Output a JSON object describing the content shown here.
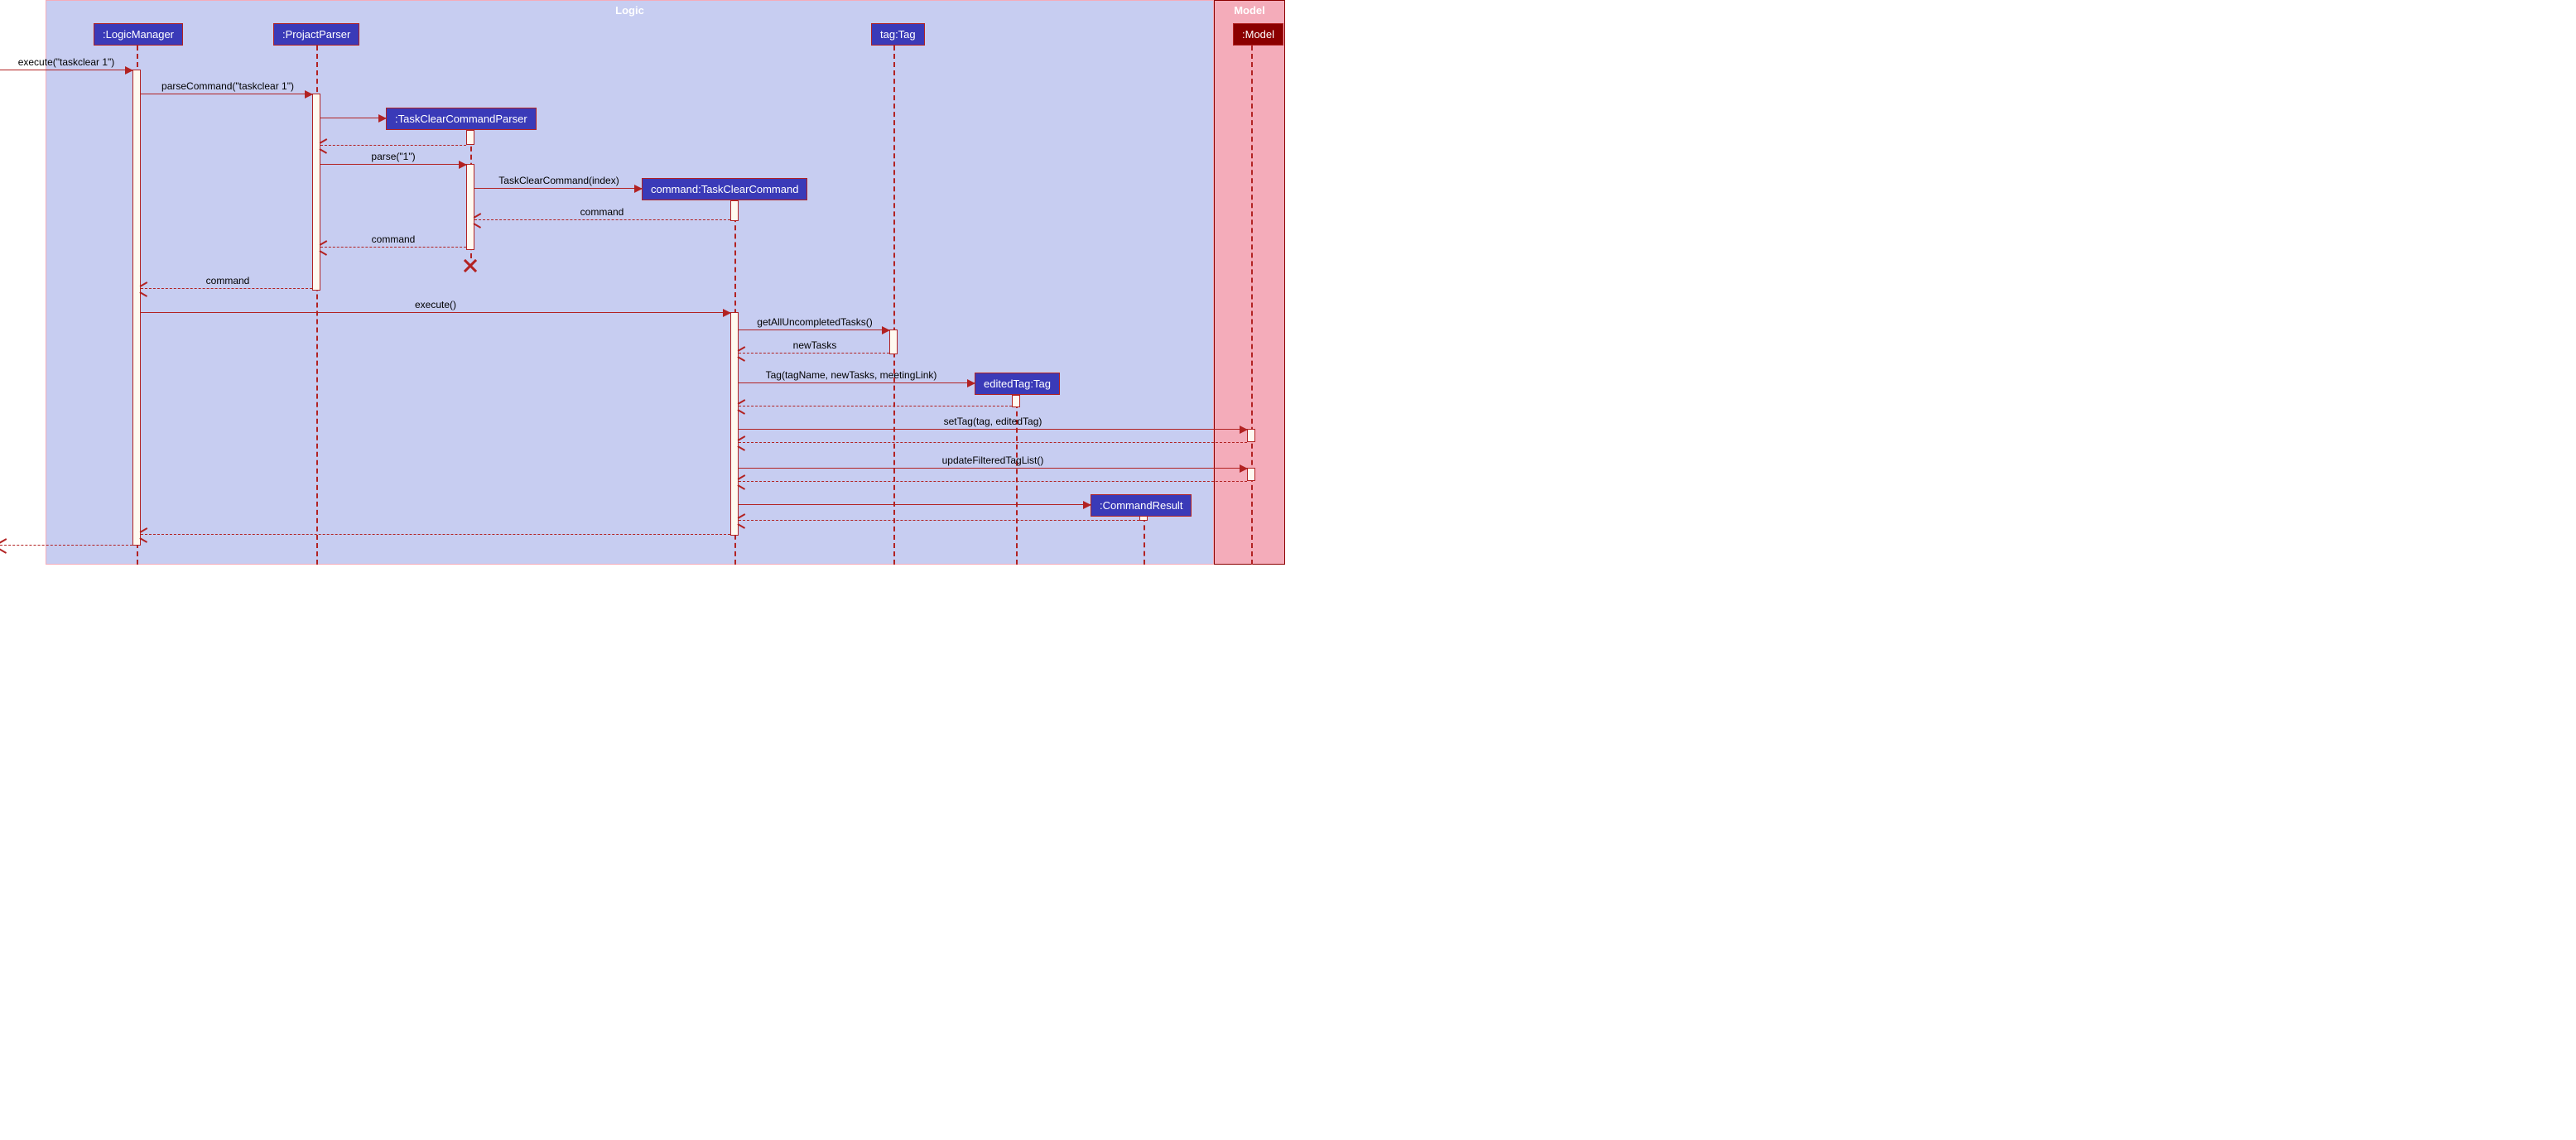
{
  "modules": {
    "logic": {
      "title": "Logic",
      "bg": "#c7cdf1",
      "border": "#f4acba",
      "title_color": "#ffffff"
    },
    "model": {
      "title": "Model",
      "bg": "#f4acba",
      "border": "#8b0000",
      "title_color": "#ffffff"
    }
  },
  "participants": {
    "logic_manager": {
      "label": ":LogicManager",
      "bg": "#3a3ab8"
    },
    "projact_parser": {
      "label": ":ProjactParser",
      "bg": "#3a3ab8"
    },
    "tccp": {
      "label": ":TaskClearCommandParser",
      "bg": "#3a3ab8"
    },
    "command": {
      "label": "command:TaskClearCommand",
      "bg": "#3a3ab8"
    },
    "tag": {
      "label": "tag:Tag",
      "bg": "#3a3ab8"
    },
    "edited_tag": {
      "label": "editedTag:Tag",
      "bg": "#3a3ab8"
    },
    "cmd_result": {
      "label": ":CommandResult",
      "bg": "#3a3ab8"
    },
    "model": {
      "label": ":Model",
      "bg": "#8b0000"
    }
  },
  "messages": {
    "m1": "execute(\"taskclear 1\")",
    "m2": "parseCommand(\"taskclear 1\")",
    "m3": "parse(\"1\")",
    "m4": "TaskClearCommand(index)",
    "r4": "command",
    "r3": "command",
    "r2": "command",
    "m5": "execute()",
    "m6": "getAllUncompletedTasks()",
    "r6": "newTasks",
    "m7": "Tag(tagName, newTasks, meetingLink)",
    "m8": "setTag(tag, editedTag)",
    "m9": "updateFilteredTagList()"
  },
  "chart_data": {
    "type": "uml-sequence",
    "modules": [
      {
        "name": "Logic",
        "participants": [
          ":LogicManager",
          ":ProjactParser",
          ":TaskClearCommandParser",
          "command:TaskClearCommand",
          "tag:Tag",
          "editedTag:Tag",
          ":CommandResult"
        ]
      },
      {
        "name": "Model",
        "participants": [
          ":Model"
        ]
      }
    ],
    "interactions": [
      {
        "from": "external",
        "to": ":LogicManager",
        "label": "execute(\"taskclear 1\")",
        "type": "sync"
      },
      {
        "from": ":LogicManager",
        "to": ":ProjactParser",
        "label": "parseCommand(\"taskclear 1\")",
        "type": "sync"
      },
      {
        "from": ":ProjactParser",
        "to": ":TaskClearCommandParser",
        "label": "",
        "type": "create"
      },
      {
        "from": ":TaskClearCommandParser",
        "to": ":ProjactParser",
        "label": "",
        "type": "return"
      },
      {
        "from": ":ProjactParser",
        "to": ":TaskClearCommandParser",
        "label": "parse(\"1\")",
        "type": "sync"
      },
      {
        "from": ":TaskClearCommandParser",
        "to": "command:TaskClearCommand",
        "label": "TaskClearCommand(index)",
        "type": "create"
      },
      {
        "from": "command:TaskClearCommand",
        "to": ":TaskClearCommandParser",
        "label": "command",
        "type": "return"
      },
      {
        "from": ":TaskClearCommandParser",
        "to": ":ProjactParser",
        "label": "command",
        "type": "return"
      },
      {
        "from": ":TaskClearCommandParser",
        "to": null,
        "label": "",
        "type": "destroy"
      },
      {
        "from": ":ProjactParser",
        "to": ":LogicManager",
        "label": "command",
        "type": "return"
      },
      {
        "from": ":LogicManager",
        "to": "command:TaskClearCommand",
        "label": "execute()",
        "type": "sync"
      },
      {
        "from": "command:TaskClearCommand",
        "to": "tag:Tag",
        "label": "getAllUncompletedTasks()",
        "type": "sync"
      },
      {
        "from": "tag:Tag",
        "to": "command:TaskClearCommand",
        "label": "newTasks",
        "type": "return"
      },
      {
        "from": "command:TaskClearCommand",
        "to": "editedTag:Tag",
        "label": "Tag(tagName, newTasks, meetingLink)",
        "type": "create"
      },
      {
        "from": "editedTag:Tag",
        "to": "command:TaskClearCommand",
        "label": "",
        "type": "return"
      },
      {
        "from": "command:TaskClearCommand",
        "to": ":Model",
        "label": "setTag(tag, editedTag)",
        "type": "sync"
      },
      {
        "from": ":Model",
        "to": "command:TaskClearCommand",
        "label": "",
        "type": "return"
      },
      {
        "from": "command:TaskClearCommand",
        "to": ":Model",
        "label": "updateFilteredTagList()",
        "type": "sync"
      },
      {
        "from": ":Model",
        "to": "command:TaskClearCommand",
        "label": "",
        "type": "return"
      },
      {
        "from": "command:TaskClearCommand",
        "to": ":CommandResult",
        "label": "",
        "type": "create"
      },
      {
        "from": ":CommandResult",
        "to": "command:TaskClearCommand",
        "label": "",
        "type": "return"
      },
      {
        "from": "command:TaskClearCommand",
        "to": ":LogicManager",
        "label": "",
        "type": "return"
      },
      {
        "from": ":LogicManager",
        "to": "external",
        "label": "",
        "type": "return"
      }
    ]
  }
}
